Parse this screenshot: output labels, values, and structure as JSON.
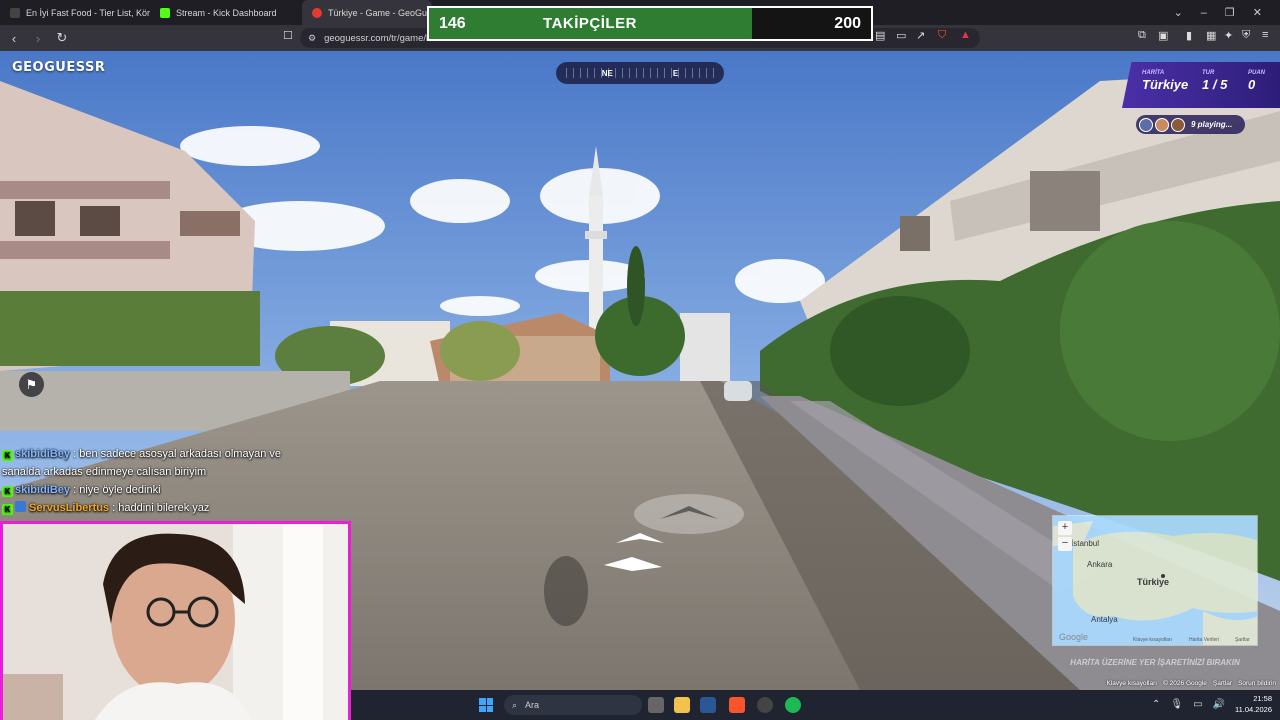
{
  "browser": {
    "tabs": [
      {
        "title": "En İyi Fast Food - Tier List, Kör Sıralası",
        "icon": "tierlist-icon",
        "color": "#4a4a4a"
      },
      {
        "title": "Stream - Kick Dashboard",
        "icon": "kick-icon",
        "color": "#53fc18"
      },
      {
        "title": "Türkiye - Game - GeoGuessr",
        "icon": "geoguessr-icon",
        "color": "#e53935"
      }
    ],
    "url": "geoguessr.com/tr/game/h"
  },
  "follower_goal": {
    "title": "TAKİPÇİLER",
    "current": "146",
    "goal": "200",
    "progress": 0.73,
    "fill_color": "#2e7d32"
  },
  "game": {
    "logo": "GEOGUESSR",
    "compass": {
      "left": "NE",
      "right": "E"
    },
    "hud": {
      "map_label": "HARİTA",
      "map_value": "Türkiye",
      "round_label": "TUR",
      "round_value": "1 / 5",
      "score_label": "PUAN",
      "score_value": "0",
      "accent": "#4b2fa8"
    },
    "playing": "9 playing...",
    "map_hint": "HARİTA ÜZERİNE YER İŞARETİNİZİ BIRAKIN",
    "minimap": {
      "labels": {
        "istanbul": "İstanbul",
        "ankara": "Ankara",
        "turkiye": "Türkiye",
        "antalya": "Antalya"
      },
      "attribution": "Google",
      "footer": [
        "Klavye kısayolları",
        "Harita Verileri",
        "Şartlar"
      ]
    },
    "footer_links": [
      "Klavye kısayolları",
      "© 2026 Google",
      "Şartlar",
      "Sorun bildirin"
    ]
  },
  "chat": {
    "messages": [
      {
        "user": "skibidiBey",
        "text": "ben sadece asosyal arkadası olmayan ve sanalda arkadas edinmeye calısan biriyim",
        "user_color": "#7fb5ff",
        "badge2": false
      },
      {
        "user": "skibidiBey",
        "text": "niye öyle dedinki",
        "user_color": "#7fb5ff",
        "badge2": false
      },
      {
        "user": "ServusLibertus",
        "text": "haddini bilerek yaz",
        "user_color": "#f2a623",
        "badge2": true
      }
    ]
  },
  "taskbar": {
    "search_placeholder": "Ara",
    "time": "21:58",
    "date": "11.04.2026"
  }
}
